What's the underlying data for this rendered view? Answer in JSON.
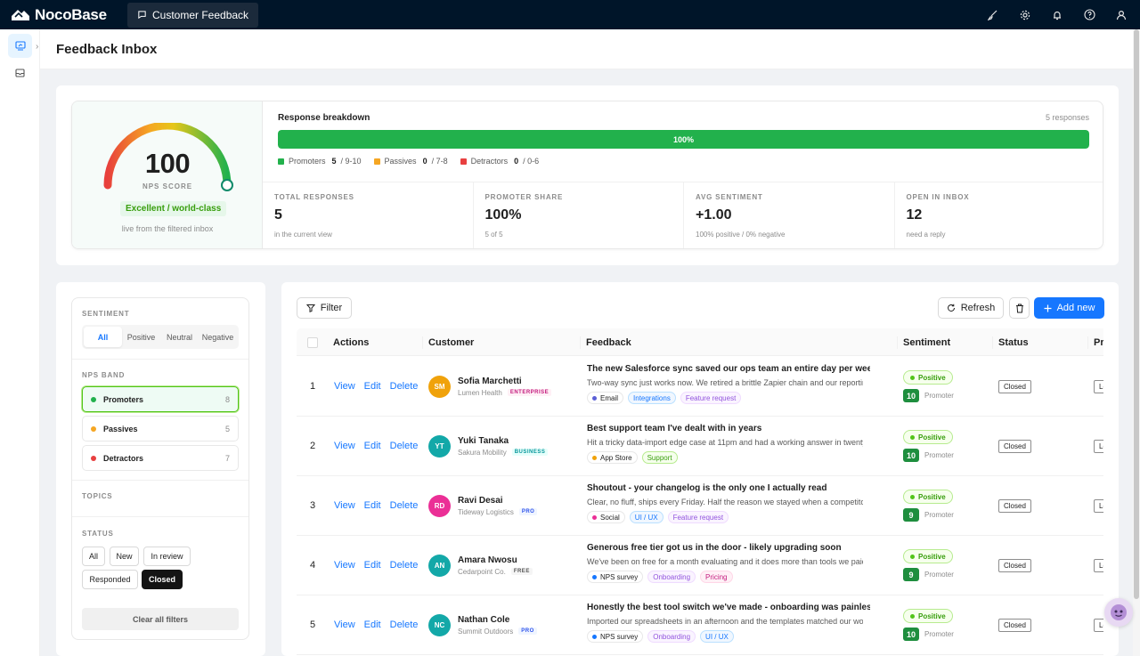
{
  "app": {
    "logo_text": "NocoBase",
    "tab_label": "Customer Feedback",
    "top_icons": [
      "paint-brush-icon",
      "gear-icon",
      "bell-icon",
      "help-icon",
      "user-icon"
    ]
  },
  "page": {
    "title": "Feedback Inbox"
  },
  "nps": {
    "score": "100",
    "score_value": 100,
    "score_label": "NPS SCORE",
    "rating": "Excellent / world-class",
    "note": "live from the filtered inbox",
    "breakdown_title": "Response breakdown",
    "response_count": "5 responses",
    "bar_label": "100%",
    "bar_fraction": 1.0,
    "legend": [
      {
        "name": "Promoters",
        "count": "5",
        "range": "/ 9-10",
        "color": "#22b14c"
      },
      {
        "name": "Passives",
        "count": "0",
        "range": "/ 7-8",
        "color": "#f5a623"
      },
      {
        "name": "Detractors",
        "count": "0",
        "range": "/ 0-6",
        "color": "#e84040"
      }
    ],
    "stats": [
      {
        "label": "TOTAL RESPONSES",
        "value": "5",
        "sub": "in the current view"
      },
      {
        "label": "PROMOTER SHARE",
        "value": "100%",
        "sub": "5 of 5"
      },
      {
        "label": "AVG SENTIMENT",
        "value": "+1.00",
        "sub": "100% positive / 0% negative"
      },
      {
        "label": "OPEN IN INBOX",
        "value": "12",
        "sub": "need a reply"
      }
    ]
  },
  "filters": {
    "sentiment_label": "SENTIMENT",
    "sentiment_options": [
      "All",
      "Positive",
      "Neutral",
      "Negative"
    ],
    "sentiment_selected": "All",
    "nps_band_label": "NPS BAND",
    "bands": [
      {
        "name": "Promoters",
        "count": "8",
        "color": "#22b14c",
        "active": true
      },
      {
        "name": "Passives",
        "count": "5",
        "color": "#f5a623",
        "active": false
      },
      {
        "name": "Detractors",
        "count": "7",
        "color": "#e84040",
        "active": false
      }
    ],
    "topics_label": "TOPICS",
    "status_label": "STATUS",
    "status_options": [
      "All",
      "New",
      "In review",
      "Responded",
      "Closed"
    ],
    "status_selected": "Closed",
    "clear_label": "Clear all filters"
  },
  "toolbar": {
    "filter_label": "Filter",
    "refresh_label": "Refresh",
    "add_label": "Add new"
  },
  "table": {
    "columns": [
      "Actions",
      "Customer",
      "Feedback",
      "Sentiment",
      "Status",
      "Pri"
    ],
    "action_labels": [
      "View",
      "Edit",
      "Delete"
    ],
    "rows": [
      {
        "index": "1",
        "initials": "SM",
        "avatar_color": "#f0a20b",
        "name": "Sofia Marchetti",
        "company": "Lumen Health",
        "tier": "ENTERPRISE",
        "tier_color": "#c41d7f",
        "tier_bg": "#fff0f6",
        "title": "The new Salesforce sync saved our ops team an entire day per week",
        "body": "Two-way sync just works now. We retired a brittle Zapier chain and our reporting finally lines up.",
        "channel": "Email",
        "channel_color": "#5b5fd6",
        "topics": [
          {
            "label": "Integrations",
            "style": "topic-a"
          },
          {
            "label": "Feature request",
            "style": "topic-b"
          }
        ],
        "sentiment": "Positive",
        "score": "10",
        "band": "Promoter",
        "status": "Closed",
        "priority": "Low"
      },
      {
        "index": "2",
        "initials": "YT",
        "avatar_color": "#13a8a8",
        "name": "Yuki Tanaka",
        "company": "Sakura Mobility",
        "tier": "BUSINESS",
        "tier_color": "#08979c",
        "tier_bg": "#e6fffb",
        "title": "Best support team I've dealt with in years",
        "body": "Hit a tricky data-import edge case at 11pm and had a working answer in twenty minutes.",
        "channel": "App Store",
        "channel_color": "#f0a20b",
        "topics": [
          {
            "label": "Support",
            "style": "topic-green"
          }
        ],
        "sentiment": "Positive",
        "score": "10",
        "band": "Promoter",
        "status": "Closed",
        "priority": "Low"
      },
      {
        "index": "3",
        "initials": "RD",
        "avatar_color": "#eb2f96",
        "name": "Ravi Desai",
        "company": "Tideway Logistics",
        "tier": "PRO",
        "tier_color": "#2f54eb",
        "tier_bg": "#f0f5ff",
        "title": "Shoutout - your changelog is the only one I actually read",
        "body": "Clear, no fluff, ships every Friday. Half the reason we stayed when a competitor called.",
        "channel": "Social",
        "channel_color": "#eb2f96",
        "topics": [
          {
            "label": "UI / UX",
            "style": "topic-a"
          },
          {
            "label": "Feature request",
            "style": "topic-b"
          }
        ],
        "sentiment": "Positive",
        "score": "9",
        "band": "Promoter",
        "status": "Closed",
        "priority": "Low"
      },
      {
        "index": "4",
        "initials": "AN",
        "avatar_color": "#13a8a8",
        "name": "Amara Nwosu",
        "company": "Cedarpoint Co.",
        "tier": "FREE",
        "tier_color": "#595959",
        "tier_bg": "#f5f5f5",
        "title": "Generous free tier got us in the door - likely upgrading soon",
        "body": "We've been on free for a month evaluating and it does more than tools we paid for.",
        "channel": "NPS survey",
        "channel_color": "#1677ff",
        "topics": [
          {
            "label": "Onboarding",
            "style": "topic-b"
          },
          {
            "label": "Pricing",
            "style": "topic-c"
          }
        ],
        "sentiment": "Positive",
        "score": "9",
        "band": "Promoter",
        "status": "Closed",
        "priority": "Low"
      },
      {
        "index": "5",
        "initials": "NC",
        "avatar_color": "#13a8a8",
        "name": "Nathan Cole",
        "company": "Summit Outdoors",
        "tier": "PRO",
        "tier_color": "#2f54eb",
        "tier_bg": "#f0f5ff",
        "title": "Honestly the best tool switch we've made - onboarding was painless",
        "body": "Imported our spreadsheets in an afternoon and the templates matched our workflow.",
        "channel": "NPS survey",
        "channel_color": "#1677ff",
        "topics": [
          {
            "label": "Onboarding",
            "style": "topic-b"
          },
          {
            "label": "UI / UX",
            "style": "topic-a"
          }
        ],
        "sentiment": "Positive",
        "score": "10",
        "band": "Promoter",
        "status": "Closed",
        "priority": "Low"
      }
    ]
  }
}
